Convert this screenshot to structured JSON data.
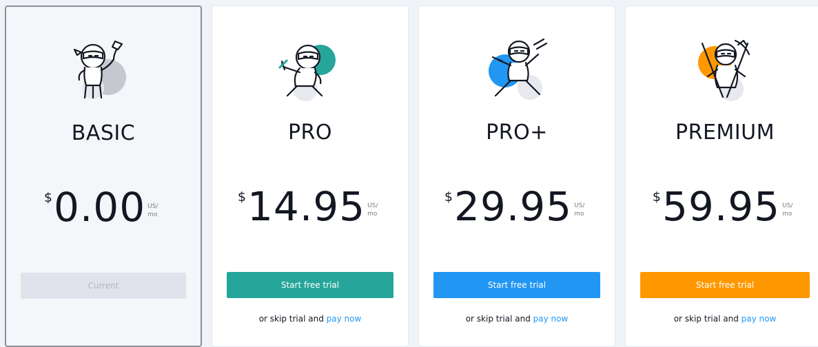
{
  "colors": {
    "pro": "#26a69a",
    "pro_plus": "#2196f3",
    "premium": "#ff9800",
    "link": "#2196f3"
  },
  "plans": [
    {
      "name": "BASIC",
      "currency": "$",
      "amount": "0.00",
      "unit_line1": "US/",
      "unit_line2": "mo",
      "button_label": "Current",
      "illustration": "ninja-kite-icon"
    },
    {
      "name": "PRO",
      "currency": "$",
      "amount": "14.95",
      "unit_line1": "US/",
      "unit_line2": "mo",
      "button_label": "Start free trial",
      "skip_text": "or skip trial and",
      "skip_link": "pay now",
      "illustration": "ninja-pointing-icon"
    },
    {
      "name": "PRO+",
      "currency": "$",
      "amount": "29.95",
      "unit_line1": "US/",
      "unit_line2": "mo",
      "button_label": "Start free trial",
      "skip_text": "or skip trial and",
      "skip_link": "pay now",
      "illustration": "ninja-stance-icon"
    },
    {
      "name": "PREMIUM",
      "currency": "$",
      "amount": "59.95",
      "unit_line1": "US/",
      "unit_line2": "mo",
      "button_label": "Start free trial",
      "skip_text": "or skip trial and",
      "skip_link": "pay now",
      "illustration": "ninja-swords-icon"
    }
  ]
}
